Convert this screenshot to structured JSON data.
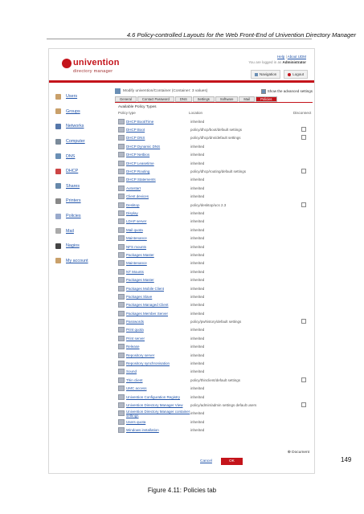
{
  "running_head": "4.6  Policy-controlled Layouts for the Web Front-End of Univention Directory Manager",
  "header": {
    "logo_word": "univention",
    "logo_sub": "directory manager",
    "link_help": "Help",
    "link_about": "About UDM",
    "logged_in_prefix": "You are logged in as",
    "user": "Administrator",
    "btn_navigation": "Navigation",
    "btn_logout": "Logout"
  },
  "sidebar": {
    "items": [
      {
        "label": "Users",
        "icon": "users-icon",
        "color": "#c9a06a"
      },
      {
        "label": "Groups",
        "icon": "groups-icon",
        "color": "#c9a06a"
      },
      {
        "label": "Networks",
        "icon": "networks-icon",
        "color": "#5577aa"
      },
      {
        "label": "Computer",
        "icon": "computer-icon",
        "color": "#7a8a9a"
      },
      {
        "label": "DNS",
        "icon": "dns-icon",
        "color": "#6a8fb5"
      },
      {
        "label": "DHCP",
        "icon": "dhcp-icon",
        "color": "#cc4444"
      },
      {
        "label": "Shares",
        "icon": "shares-icon",
        "color": "#6688aa"
      },
      {
        "label": "Printers",
        "icon": "printers-icon",
        "color": "#888888"
      },
      {
        "label": "Policies",
        "icon": "policies-icon",
        "color": "#99aacc"
      },
      {
        "label": "Mail",
        "icon": "mail-icon",
        "color": "#aaaaaa"
      },
      {
        "label": "Nagios",
        "icon": "nagios-icon",
        "color": "#444444"
      },
      {
        "label": "My account",
        "icon": "account-icon",
        "color": "#c9a06a"
      }
    ]
  },
  "main": {
    "object_title": "Modify univention/Container (Container: 3 values)",
    "advanced_label": "Show the advanced settings",
    "tabs": [
      "General",
      "Contact Password",
      "DNS",
      "Settings",
      "Software",
      "Mail",
      "Policies"
    ],
    "active_tab": "Policies",
    "section_title": "Available Policy Types",
    "col_type": "Policy type",
    "col_location": "Location",
    "col_connect": "Disconnect",
    "rows": [
      {
        "type": "DHCP Boot/Time",
        "location": "inherited",
        "box": false
      },
      {
        "type": "DHCP Boot",
        "location": "policy/dhcp/boot/default settings",
        "box": true
      },
      {
        "type": "DHCP DNS",
        "location": "policy/dhcp/dns/default settings",
        "box": true
      },
      {
        "type": "DHCP Dynamic DNS",
        "location": "inherited",
        "box": false
      },
      {
        "type": "DHCP Netbios",
        "location": "inherited",
        "box": false
      },
      {
        "type": "DHCP Leasetime",
        "location": "inherited",
        "box": false
      },
      {
        "type": "DHCP Routing",
        "location": "policy/dhcp/routing/default settings",
        "box": true
      },
      {
        "type": "DHCP Statements",
        "location": "inherited",
        "box": false
      },
      {
        "type": "Autostart",
        "location": "inherited",
        "box": false
      },
      {
        "type": "Client devices",
        "location": "inherited",
        "box": false
      },
      {
        "type": "Desktop",
        "location": "policy/desktop/ucs 2.3",
        "box": true
      },
      {
        "type": "Display",
        "location": "inherited",
        "box": false
      },
      {
        "type": "LDAP server",
        "location": "inherited",
        "box": false
      },
      {
        "type": "Mail quota",
        "location": "inherited",
        "box": false
      },
      {
        "type": "Maintenance",
        "location": "inherited",
        "box": false
      },
      {
        "type": "NFS mounts",
        "location": "inherited",
        "box": false
      },
      {
        "type": "Packages Master",
        "location": "inherited",
        "box": false
      },
      {
        "type": "Maintenance",
        "location": "inherited",
        "box": false
      },
      {
        "type": "NT Mounts",
        "location": "inherited",
        "box": false
      },
      {
        "type": "Packages Master",
        "location": "inherited",
        "box": false
      },
      {
        "type": "Packages Mobile Client",
        "location": "inherited",
        "box": false
      },
      {
        "type": "Packages Slave",
        "location": "inherited",
        "box": false
      },
      {
        "type": "Packages Managed Client",
        "location": "inherited",
        "box": false
      },
      {
        "type": "Packages Member Server",
        "location": "inherited",
        "box": false
      },
      {
        "type": "Passwords",
        "location": "policy/pwhistory/default settings",
        "box": true
      },
      {
        "type": "Print quota",
        "location": "inherited",
        "box": false
      },
      {
        "type": "Print server",
        "location": "inherited",
        "box": false
      },
      {
        "type": "Release",
        "location": "inherited",
        "box": false
      },
      {
        "type": "Repository server",
        "location": "inherited",
        "box": false
      },
      {
        "type": "Repository synchronisation",
        "location": "inherited",
        "box": false
      },
      {
        "type": "Sound",
        "location": "inherited",
        "box": false
      },
      {
        "type": "Thin client",
        "location": "policy/thinclient/default settings",
        "box": true
      },
      {
        "type": "UMC access",
        "location": "inherited",
        "box": false
      },
      {
        "type": "Univention Configuration Registry",
        "location": "inherited",
        "box": false
      },
      {
        "type": "Univention Directory Manager View",
        "location": "policy/admin/admin settings default users",
        "box": true
      },
      {
        "type": "Univention Directory Manager container settings",
        "location": "inherited",
        "box": false
      },
      {
        "type": "Users quota",
        "location": "inherited",
        "box": false
      },
      {
        "type": "Windows installation",
        "location": "inherited",
        "box": false
      }
    ],
    "document_link": "Document",
    "cancel_label": "Cancel",
    "ok_label": "OK"
  },
  "page_number": "149",
  "caption": "Figure 4.11: Policies tab"
}
